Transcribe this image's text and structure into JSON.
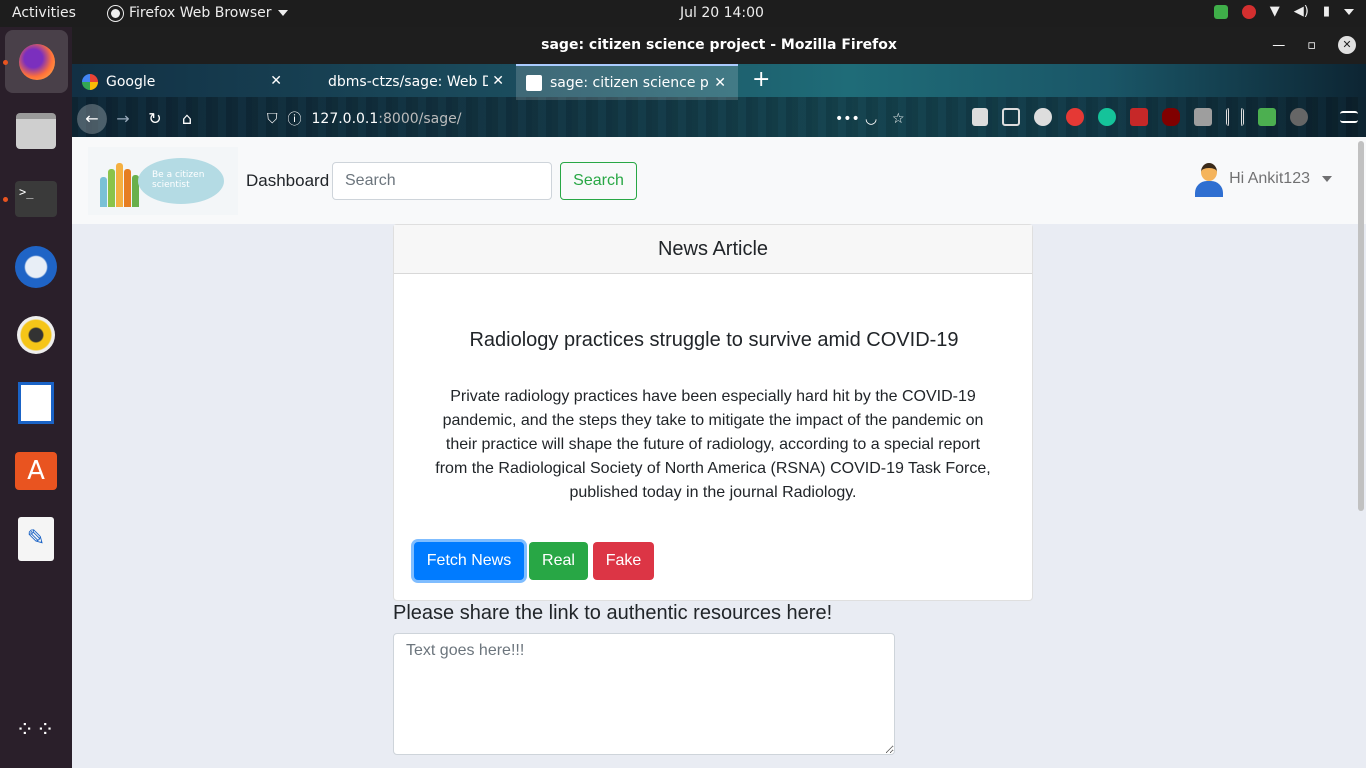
{
  "system_bar": {
    "activities": "Activities",
    "app_menu": "Firefox Web Browser",
    "clock": "Jul 20  14:00"
  },
  "window": {
    "title": "sage: citizen science project - Mozilla Firefox"
  },
  "tabs": [
    {
      "label": "Google",
      "favicon": "google-icon"
    },
    {
      "label": "dbms-ctzs/sage: Web De",
      "favicon": "github-icon"
    },
    {
      "label": "sage: citizen science proj",
      "favicon": "page-icon"
    }
  ],
  "address_bar": {
    "host": "127.0.0.1",
    "path": ":8000/sage/"
  },
  "site": {
    "logo_text_1": "Be a citizen",
    "logo_text_2": "scientist",
    "nav_dashboard": "Dashboard",
    "search_placeholder": "Search",
    "search_button": "Search",
    "user_greeting": "Hi Ankit123"
  },
  "article_card": {
    "header": "News Article",
    "headline": "Radiology practices struggle to survive amid COVID-19",
    "body": "Private radiology practices have been especially hard hit by the COVID-19 pandemic, and the steps they take to mitigate the impact of the pandemic on their practice will shape the future of radiology, according to a special report from the Radiological Society of North America (RSNA) COVID-19 Task Force, published today in the journal Radiology.",
    "fetch_button": "Fetch News",
    "real_button": "Real",
    "fake_button": "Fake"
  },
  "share": {
    "label": "Please share the link to authentic resources here!",
    "placeholder": "Text goes here!!!"
  },
  "colors": {
    "primary": "#007bff",
    "success": "#28a745",
    "danger": "#dc3545",
    "page_bg": "#e9ecf3"
  }
}
